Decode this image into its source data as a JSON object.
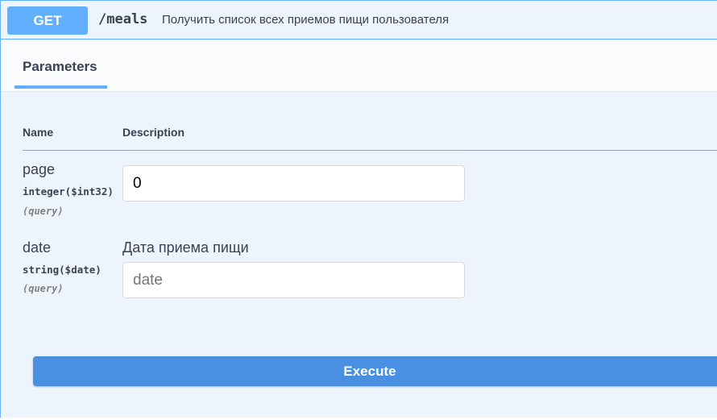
{
  "operation": {
    "method": "GET",
    "path": "/meals",
    "summary": "Получить список всех приемов пищи пользователя",
    "method_color": "#61affe"
  },
  "tabs": {
    "parameters": "Parameters"
  },
  "table": {
    "col_name": "Name",
    "col_description": "Description"
  },
  "params": [
    {
      "name": "page",
      "type": "integer($int32)",
      "in": "(query)",
      "description": "",
      "value": "0",
      "placeholder": ""
    },
    {
      "name": "date",
      "type": "string($date)",
      "in": "(query)",
      "description": "Дата приема пищи",
      "value": "",
      "placeholder": "date"
    }
  ],
  "actions": {
    "execute": "Execute",
    "execute_color": "#4990e2"
  }
}
